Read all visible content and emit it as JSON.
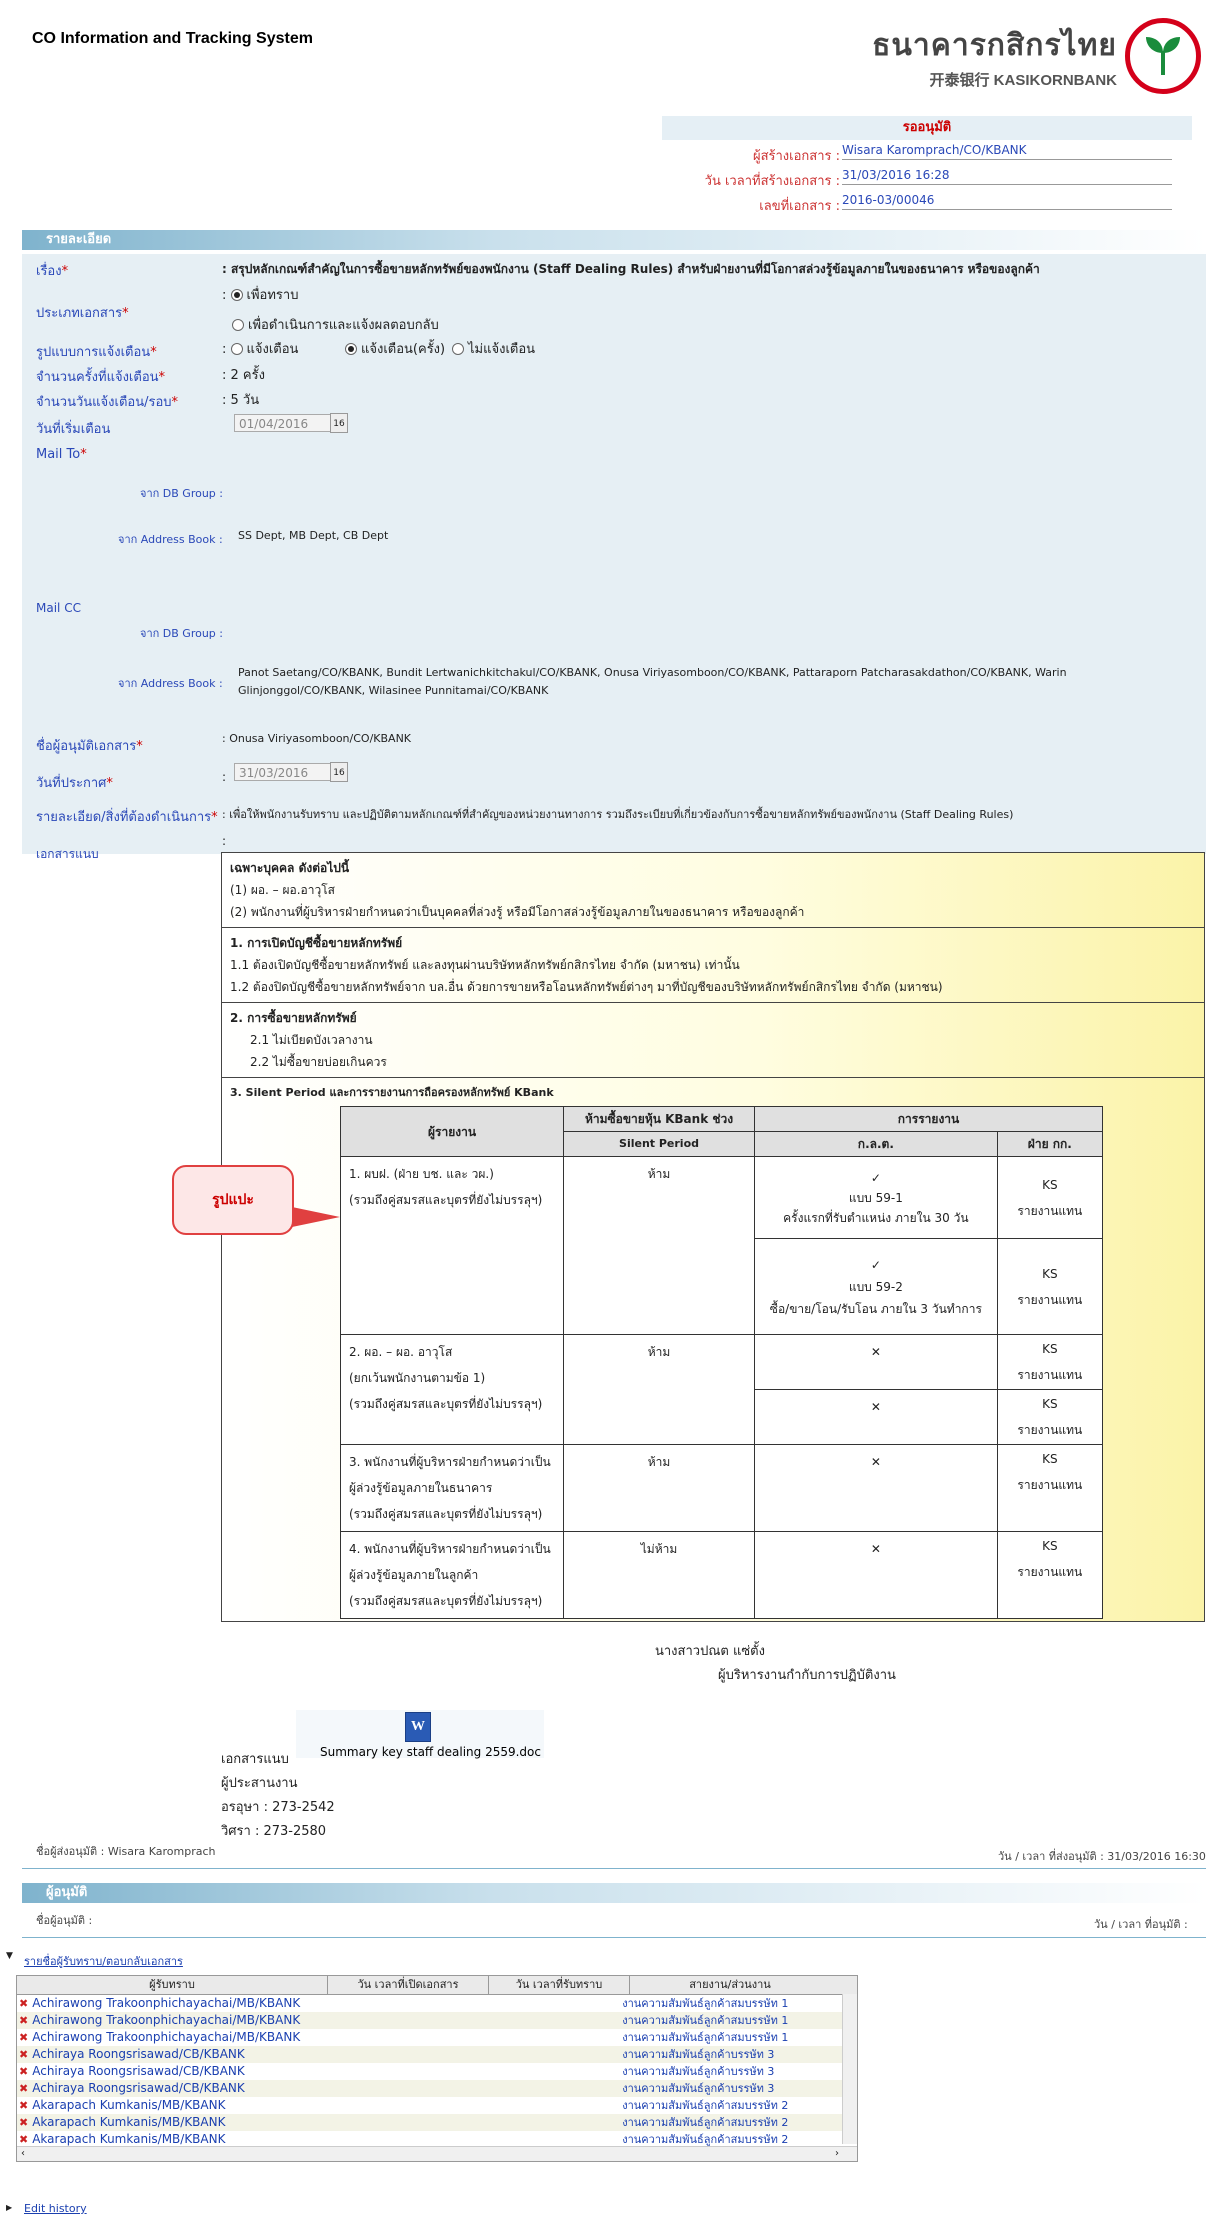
{
  "app_title": "CO Information and Tracking System",
  "logo": {
    "thai": "ธนาคารกสิกรไทย",
    "en": "开泰银行 KASIKORNBANK"
  },
  "status": "รออนุมัติ",
  "meta": {
    "creator_label": "ผู้สร้างเอกสาร :",
    "creator": "Wisara Karomprach/CO/KBANK",
    "created_label": "วัน เวลาที่สร้างเอกสาร :",
    "created": "31/03/2016 16:28",
    "docno_label": "เลขที่เอกสาร :",
    "docno": "2016-03/00046"
  },
  "detail_header": "รายละเอียด",
  "form": {
    "subject_label": "เรื่อง",
    "subject": "สรุปหลักเกณฑ์สำคัญในการซื้อขายหลักทรัพย์ของพนักงาน (Staff Dealing Rules) สำหรับฝ่ายงานที่มีโอกาสล่วงรู้ข้อมูลภายในของธนาคาร หรือของลูกค้า",
    "doctype_label": "ประเภทเอกสาร",
    "doctype_opt1": "เพื่อทราบ",
    "doctype_opt2": "เพื่อดำเนินการและแจ้งผลตอบกลับ",
    "notify_label": "รูปแบบการแจ้งเตือน",
    "notify_opt1": "แจ้งเตือน",
    "notify_opt2": "แจ้งเตือน(ครั้ง)",
    "notify_opt3": "ไม่แจ้งเตือน",
    "count_label": "จำนวนครั้งที่แจ้งเตือน",
    "count": "2 ครั้ง",
    "days_label": "จำนวนวันแจ้งเตือน/รอบ",
    "days": "5 วัน",
    "start_label": "วันที่เริ่มเตือน",
    "start_date": "01/04/2016",
    "mailto_label": "Mail To",
    "db_group_label": "จาก DB Group",
    "address_book_label": "จาก Address Book",
    "mailto_address": "SS Dept, MB Dept, CB Dept",
    "mailcc_label": "Mail CC",
    "mailcc_address": "Panot Saetang/CO/KBANK, Bundit Lertwanichkitchakul/CO/KBANK, Onusa Viriyasomboon/CO/KBANK, Pattaraporn Patcharasakdathon/CO/KBANK, Warin Glinjonggol/CO/KBANK, Wilasinee Punnitamai/CO/KBANK",
    "approver_label": "ชื่อผู้อนุมัติเอกสาร",
    "approver": "Onusa Viriyasomboon/CO/KBANK",
    "announce_label": "วันที่ประกาศ",
    "announce_date": "31/03/2016",
    "action_label": "รายละเอียด/สิ่งที่ต้องดำเนินการ",
    "action": "เพื่อให้พนักงานรับทราบ และปฏิบัติตามหลักเกณฑ์ที่สำคัญของหน่วยงานทางการ รวมถึงระเบียบที่เกี่ยวข้องกับการซื้อขายหลักทรัพย์ของพนักงาน (Staff Dealing Rules)",
    "attach_label": "เอกสารแนบ"
  },
  "doc": {
    "intro_title": "เฉพาะบุคคล ดังต่อไปนี้",
    "intro_1": "(1)  ผอ. – ผอ.อาวุโส",
    "intro_2": "(2)  พนักงานที่ผู้บริหารฝ่ายกำหนดว่าเป็นบุคคลที่ล่วงรู้ หรือมีโอกาสล่วงรู้ข้อมูลภายในของธนาคาร หรือของลูกค้า",
    "s1_title": "1. การเปิดบัญชีซื้อขายหลักทรัพย์",
    "s1_1": "1.1 ต้องเปิดบัญชีซื้อขายหลักทรัพย์ และลงทุนผ่านบริษัทหลักทรัพย์กสิกรไทย จำกัด (มหาชน) เท่านั้น",
    "s1_2": "1.2 ต้องปิดบัญชีซื้อขายหลักทรัพย์จาก บล.อื่น ด้วยการขายหรือโอนหลักทรัพย์ต่างๆ มาที่บัญชีของบริษัทหลักทรัพย์กสิกรไทย จำกัด (มหาชน)",
    "s2_title": "2. การซื้อขายหลักทรัพย์",
    "s2_1": "2.1 ไม่เบียดบังเวลางาน",
    "s2_2": "2.2 ไม่ซื้อขายบ่อยเกินควร",
    "s3_title": "3. Silent Period และการรายงานการถือครองหลักทรัพย์ KBank",
    "th_reporter": "ผู้รายงาน",
    "th_ban": "ห้ามซื้อขายหุ้น KBank ช่วง",
    "th_silent": "Silent Period",
    "th_report": "การรายงาน",
    "th_sec": "ก.ล.ต.",
    "th_ks": "ฝ่าย กก.",
    "r1_a": "1. ผบฝ. (ฝ่าย บช. และ วผ.)",
    "r1_b": "(รวมถึงคู่สมรสและบุตรที่ยังไม่บรรลุฯ)",
    "r1_ban": "ห้าม",
    "r1_sec1_a": "แบบ 59-1",
    "r1_sec1_b": "ครั้งแรกที่รับตำแหน่ง ภายใน 30 วัน",
    "r1_sec2_a": "แบบ 59-2",
    "r1_sec2_b": "ซื้อ/ขาย/โอน/รับโอน ภายใน 3 วันทำการ",
    "ks": "KS",
    "ks_report": "รายงานแทน",
    "r2_a": "2. ผอ. – ผอ. อาวุโส",
    "r2_b": "(ยกเว้นพนักงานตามข้อ 1)",
    "r2_c": "(รวมถึงคู่สมรสและบุตรที่ยังไม่บรรลุฯ)",
    "r2_ban": "ห้าม",
    "r3_a": "3. พนักงานที่ผู้บริหารฝ่ายกำหนดว่าเป็น",
    "r3_b": "ผู้ล่วงรู้ข้อมูลภายในธนาคาร",
    "r3_c": "(รวมถึงคู่สมรสและบุตรที่ยังไม่บรรลุฯ)",
    "r3_ban": "ห้าม",
    "r4_a": "4. พนักงานที่ผู้บริหารฝ่ายกำหนดว่าเป็น",
    "r4_b": "ผู้ล่วงรู้ข้อมูลภายในลูกค้า",
    "r4_c": "(รวมถึงคู่สมรสและบุตรที่ยังไม่บรรลุฯ)",
    "r4_ban": "ไม่ห้าม",
    "check": "✓",
    "cross": "✕"
  },
  "callout": "รูปแปะ",
  "signer": {
    "name": "นางสาวปณต แซ่ตั้ง",
    "title": "ผู้บริหารงานกำกับการปฏิบัติงาน"
  },
  "attachment": {
    "file": "Summary key staff dealing 2559.doc",
    "label": "เอกสารแนบ"
  },
  "coordinator": {
    "label": "ผู้ประสานงาน",
    "p1": "อรอุษา : 273-2542",
    "p2": "วิศรา : 273-2580"
  },
  "footer1": {
    "sender": "ชื่อผู้ส่งอนุมัติ : Wisara Karomprach",
    "time": "วัน / เวลา ที่ส่งอนุมัติ : 31/03/2016 16:30"
  },
  "approver_header": "ผู้อนุมัติ",
  "footer2": {
    "approver": "ชื่อผู้อนุมัติ :",
    "time": "วัน / เวลา ที่อนุมัติ :"
  },
  "recipients_link": "รายชื่อผู้รับทราบ/ตอบกลับเอกสาร",
  "grid": {
    "headers": [
      "ผู้รับทราบ",
      "วัน เวลาที่เปิดเอกสาร",
      "วัน เวลาที่รับทราบ",
      "สายงาน/ส่วนงาน"
    ],
    "rows": [
      {
        "name": "Achirawong Trakoonphichayachai/MB/KBANK",
        "dept": "งานความสัมพันธ์ลูกค้าสมบรรษัท 1"
      },
      {
        "name": "Achirawong Trakoonphichayachai/MB/KBANK",
        "dept": "งานความสัมพันธ์ลูกค้าสมบรรษัท 1"
      },
      {
        "name": "Achirawong Trakoonphichayachai/MB/KBANK",
        "dept": "งานความสัมพันธ์ลูกค้าสมบรรษัท 1"
      },
      {
        "name": "Achiraya Roongsrisawad/CB/KBANK",
        "dept": "งานความสัมพันธ์ลูกค้าบรรษัท 3"
      },
      {
        "name": "Achiraya Roongsrisawad/CB/KBANK",
        "dept": "งานความสัมพันธ์ลูกค้าบรรษัท 3"
      },
      {
        "name": "Achiraya Roongsrisawad/CB/KBANK",
        "dept": "งานความสัมพันธ์ลูกค้าบรรษัท 3"
      },
      {
        "name": "Akarapach Kumkanis/MB/KBANK",
        "dept": "งานความสัมพันธ์ลูกค้าสมบรรษัท 2"
      },
      {
        "name": "Akarapach Kumkanis/MB/KBANK",
        "dept": "งานความสัมพันธ์ลูกค้าสมบรรษัท 2"
      },
      {
        "name": "Akarapach Kumkanis/MB/KBANK",
        "dept": "งานความสัมพันธ์ลูกค้าสมบรรษัท 2"
      }
    ]
  },
  "edit_history": "Edit history"
}
